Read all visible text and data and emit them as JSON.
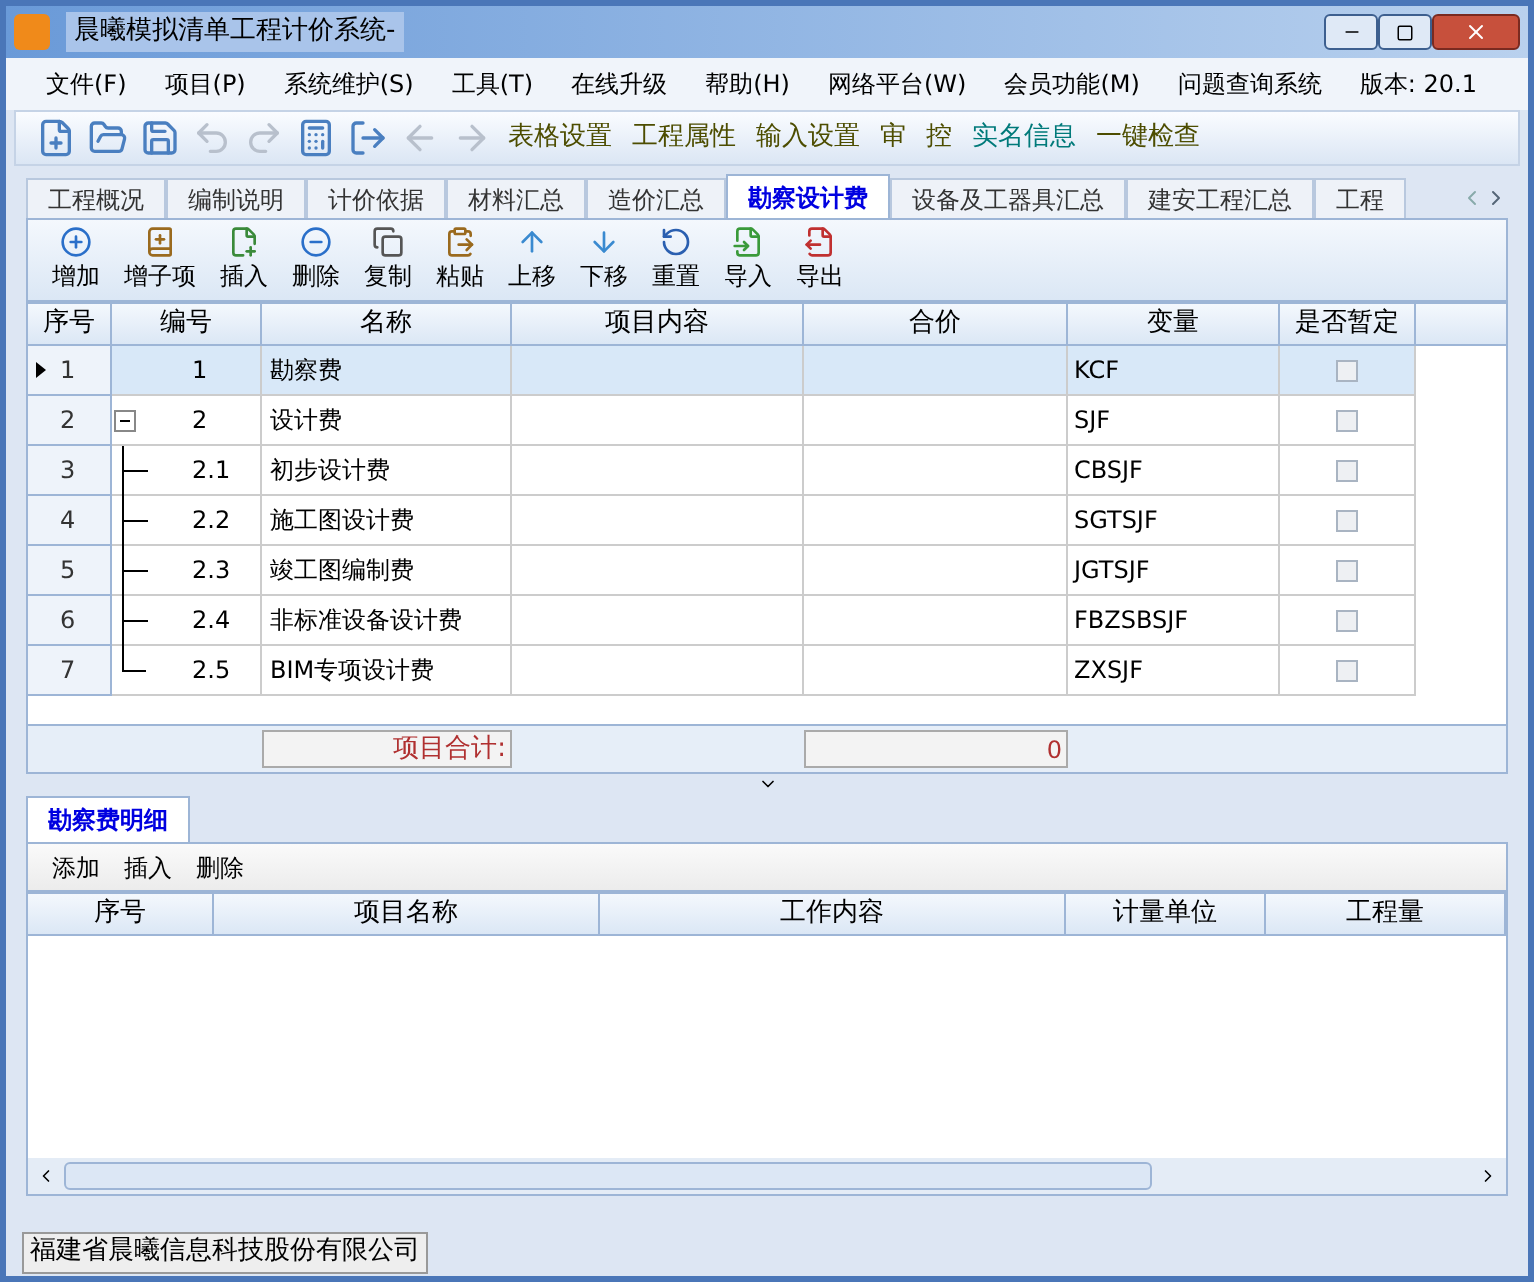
{
  "window": {
    "title": "晨曦模拟清单工程计价系统-"
  },
  "menu": [
    {
      "label": "文件(F)"
    },
    {
      "label": "项目(P)"
    },
    {
      "label": "系统维护(S)"
    },
    {
      "label": "工具(T)"
    },
    {
      "label": "在线升级"
    },
    {
      "label": "帮助(H)"
    },
    {
      "label": "网络平台(W)"
    },
    {
      "label": "会员功能(M)"
    },
    {
      "label": "问题查询系统"
    }
  ],
  "version": "版本: 20.1",
  "icon_buttons": [
    {
      "kind": "new",
      "disabled": false
    },
    {
      "kind": "open",
      "disabled": false
    },
    {
      "kind": "save",
      "disabled": false
    },
    {
      "kind": "undo",
      "disabled": true
    },
    {
      "kind": "redo",
      "disabled": true
    },
    {
      "kind": "calc",
      "disabled": false
    },
    {
      "kind": "exit",
      "disabled": false
    },
    {
      "kind": "prev",
      "disabled": true
    },
    {
      "kind": "next",
      "disabled": true
    }
  ],
  "text_buttons": [
    {
      "label": "表格设置",
      "color": "#4d4d00"
    },
    {
      "label": "工程属性",
      "color": "#4d4d00"
    },
    {
      "label": "输入设置",
      "color": "#4d4d00"
    },
    {
      "label": "审",
      "color": "#4d4d00"
    },
    {
      "label": "控",
      "color": "#4d4d00"
    },
    {
      "label": "实名信息",
      "color": "#007a7a"
    },
    {
      "label": "一键检查",
      "color": "#4d4d00"
    }
  ],
  "tabs": [
    {
      "label": "工程概况",
      "selected": false
    },
    {
      "label": "编制说明",
      "selected": false
    },
    {
      "label": "计价依据",
      "selected": false
    },
    {
      "label": "材料汇总",
      "selected": false
    },
    {
      "label": "造价汇总",
      "selected": false
    },
    {
      "label": "勘察设计费",
      "selected": true
    },
    {
      "label": "设备及工器具汇总",
      "selected": false
    },
    {
      "label": "建安工程汇总",
      "selected": false
    },
    {
      "label": "工程",
      "selected": false
    }
  ],
  "actions": [
    {
      "label": "增加",
      "kind": "add"
    },
    {
      "label": "增子项",
      "kind": "addchild"
    },
    {
      "label": "插入",
      "kind": "insert"
    },
    {
      "label": "删除",
      "kind": "delete"
    },
    {
      "label": "复制",
      "kind": "copy"
    },
    {
      "label": "粘贴",
      "kind": "paste"
    },
    {
      "label": "上移",
      "kind": "up"
    },
    {
      "label": "下移",
      "kind": "down"
    },
    {
      "label": "重置",
      "kind": "reset"
    },
    {
      "label": "导入",
      "kind": "import"
    },
    {
      "label": "导出",
      "kind": "export"
    }
  ],
  "table": {
    "columns": [
      "序号",
      "编号",
      "名称",
      "项目内容",
      "合价",
      "变量",
      "是否暂定"
    ],
    "rows": [
      {
        "seq": "1",
        "code": "1",
        "name": "勘察费",
        "variable": "KCF",
        "tentative": false,
        "selected": true
      },
      {
        "seq": "2",
        "code": "2",
        "name": "设计费",
        "variable": "SJF",
        "tentative": false,
        "selected": false,
        "expanded": true,
        "children": [
          {
            "seq": "3",
            "code": "2.1",
            "name": "初步设计费",
            "variable": "CBSJF",
            "tentative": false,
            "selected": false
          },
          {
            "seq": "4",
            "code": "2.2",
            "name": "施工图设计费",
            "variable": "SGTSJF",
            "tentative": false,
            "selected": false
          },
          {
            "seq": "5",
            "code": "2.3",
            "name": "竣工图编制费",
            "variable": "JGTSJF",
            "tentative": false,
            "selected": false
          },
          {
            "seq": "6",
            "code": "2.4",
            "name": "非标准设备设计费",
            "variable": "FBZSBSJF",
            "tentative": false,
            "selected": false
          },
          {
            "seq": "7",
            "code": "2.5",
            "name": "BIM专项设计费",
            "variable": "ZXSJF",
            "tentative": false,
            "selected": false
          }
        ]
      }
    ],
    "total_label": "项目合计:",
    "total_value": "0"
  },
  "detail": {
    "tabs": [
      {
        "label": "勘察费明细",
        "selected": true
      }
    ],
    "actions": [
      "添加",
      "插入",
      "删除"
    ],
    "columns": [
      "序号",
      "项目名称",
      "工作内容",
      "计量单位",
      "工程量"
    ]
  },
  "status_bar": "福建省晨曦信息科技股份有限公司"
}
